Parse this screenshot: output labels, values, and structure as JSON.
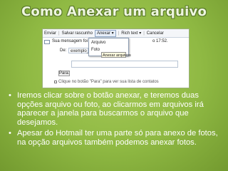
{
  "title": "Como Anexar um arquivo",
  "screenshot": {
    "toolbar": {
      "enviar": "Enviar",
      "salvar": "Salvar rascunho",
      "anexar": "Anexar ▾",
      "rich": "Rich text ▾",
      "sep": "|",
      "cancelar": "Cancelar"
    },
    "message_prefix": "Sua mensagem foi sa",
    "message_time": "o 17:52.",
    "dropdown_items": [
      "Arquivo",
      "Foto"
    ],
    "tooltip": "Anexar arquivos",
    "de_label": "De:",
    "de_value": "exemplo_o",
    "para_label": "Para:",
    "hint": "Clique no botão \"Para\" para ver sua lista de contatos"
  },
  "bullets": [
    "Iremos clicar sobre o botão anexar, e teremos duas opções arquivo ou foto, ao clicarmos em arquivos irá aparecer a janela para buscarmos o arquivo que desejamos.",
    "Apesar do Hotmail ter uma parte só para anexo de fotos, na opção arquivos também podemos anexar fotos."
  ]
}
